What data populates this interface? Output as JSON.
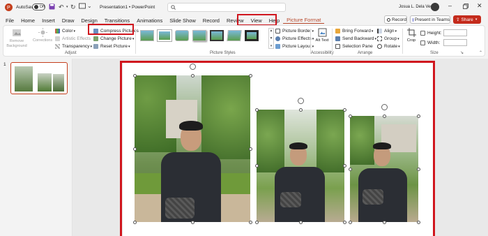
{
  "titlebar": {
    "autosave_label": "AutoSave",
    "autosave_state": "Off",
    "document_title": "Presentation1 • PowerPoint",
    "search_placeholder": "",
    "user_name": "Josua L. Dela Vega"
  },
  "menu": {
    "tabs": [
      "File",
      "Home",
      "Insert",
      "Draw",
      "Design",
      "Transitions",
      "Animations",
      "Slide Show",
      "Record",
      "Review",
      "View",
      "Help",
      "Picture Format"
    ],
    "active_tab": "Picture Format",
    "record_label": "Record",
    "present_label": "Present in Teams",
    "share_label": "Share"
  },
  "ribbon": {
    "remove_background": "Remove Background",
    "corrections": "Corrections",
    "color": "Color",
    "artistic_effects": "Artistic Effects",
    "transparency": "Transparency",
    "compress_pictures": "Compress Pictures",
    "change_picture": "Change Picture",
    "reset_picture": "Reset Picture",
    "adjust_group": "Adjust",
    "picture_styles_group": "Picture Styles",
    "picture_border": "Picture Border",
    "picture_effects": "Picture Effects",
    "picture_layout": "Picture Layout",
    "alt_text": "Alt Text",
    "accessibility_group": "Accessibility",
    "bring_forward": "Bring Forward",
    "send_backward": "Send Backward",
    "selection_pane": "Selection Pane",
    "align": "Align",
    "group": "Group",
    "rotate": "Rotate",
    "arrange_group": "Arrange",
    "crop": "Crop",
    "height_label": "Height:",
    "width_label": "Width:",
    "height_value": "",
    "width_value": "",
    "size_group": "Size"
  },
  "slides_pane": {
    "slide_number": "1"
  },
  "colors": {
    "accent_red": "#d0161e",
    "ppt_orange": "#c43e1c",
    "share_red": "#c42b1c"
  }
}
